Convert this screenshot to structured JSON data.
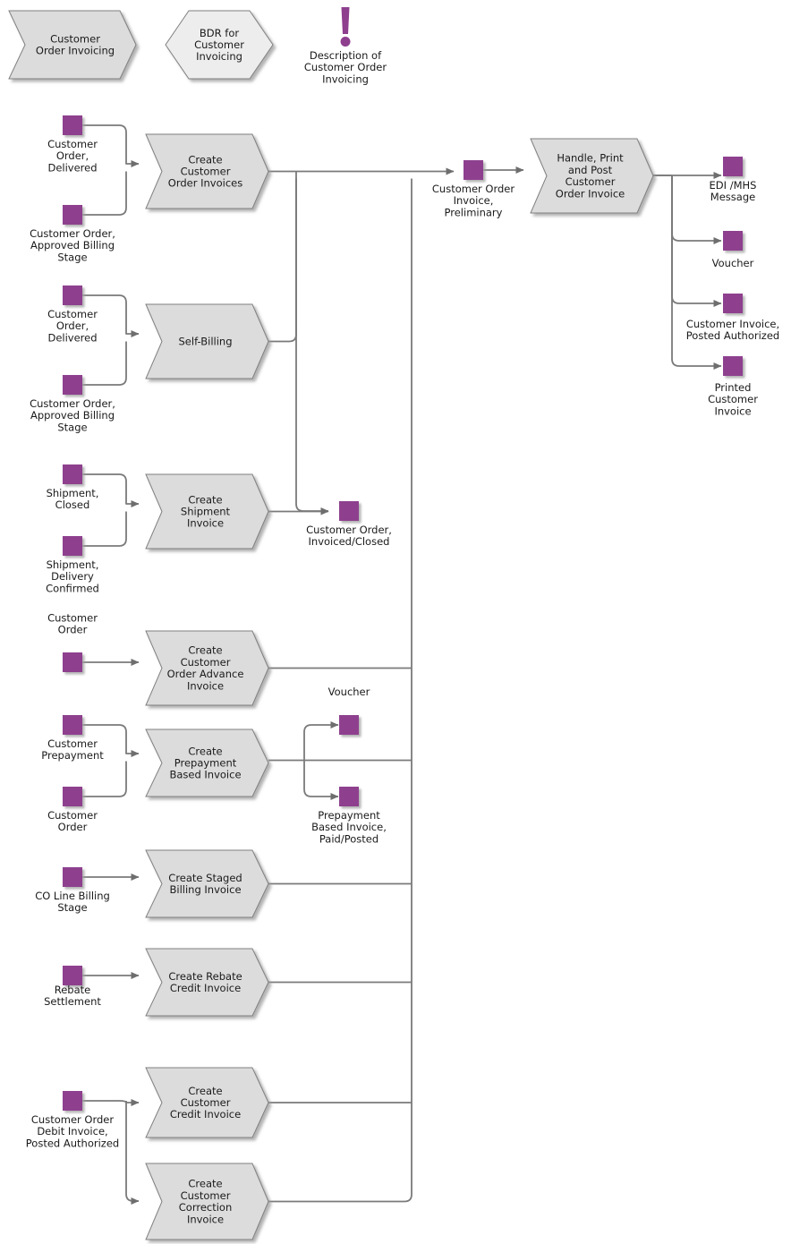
{
  "diagram": {
    "title": "Customer Order Invoicing",
    "type": "process-flow",
    "colors": {
      "accent_purple": "#8e3f8e",
      "shape_fill": "#dcdcdc",
      "hex_fill": "#ededed",
      "stroke": "#808080",
      "line": "#7a7a7a",
      "text": "#1a1a1a"
    }
  },
  "header": {
    "process_chevron": "Customer\nOrder Invoicing",
    "process_chevron_lines": [
      "Customer",
      "Order Invoicing"
    ],
    "bdr_hexagon_lines": [
      "BDR for",
      "Customer",
      "Invoicing"
    ],
    "description_icon": "exclamation-icon",
    "description_lines": [
      "Description of",
      "Customer Order",
      "Invoicing"
    ]
  },
  "activities": [
    {
      "id": "create-customer-order-invoices",
      "lines": [
        "Create",
        "Customer",
        "Order Invoices"
      ]
    },
    {
      "id": "self-billing",
      "lines": [
        "Self-Billing"
      ]
    },
    {
      "id": "create-shipment-invoice",
      "lines": [
        "Create",
        "Shipment",
        "Invoice"
      ]
    },
    {
      "id": "create-customer-order-advance-invoice",
      "lines": [
        "Create",
        "Customer",
        "Order Advance",
        "Invoice"
      ]
    },
    {
      "id": "create-prepayment-based-invoice",
      "lines": [
        "Create",
        "Prepayment",
        "Based Invoice"
      ]
    },
    {
      "id": "create-staged-billing-invoice",
      "lines": [
        "Create Staged",
        "Billing Invoice"
      ]
    },
    {
      "id": "create-rebate-credit-invoice",
      "lines": [
        "Create Rebate",
        "Credit Invoice"
      ]
    },
    {
      "id": "create-customer-credit-invoice",
      "lines": [
        "Create",
        "Customer",
        "Credit Invoice"
      ]
    },
    {
      "id": "create-customer-correction-invoice",
      "lines": [
        "Create",
        "Customer",
        "Correction",
        "Invoice"
      ]
    },
    {
      "id": "handle-print-and-post-customer-order-invoice",
      "lines": [
        "Handle, Print",
        "and Post",
        "Customer",
        "Order Invoice"
      ]
    }
  ],
  "objects": [
    {
      "id": "customer-order-delivered-1",
      "lines": [
        "Customer",
        "Order,",
        "Delivered"
      ]
    },
    {
      "id": "customer-order-approved-billing-stage-1",
      "lines": [
        "Customer Order,",
        "Approved Billing",
        "Stage"
      ]
    },
    {
      "id": "customer-order-delivered-2",
      "lines": [
        "Customer",
        "Order,",
        "Delivered"
      ]
    },
    {
      "id": "customer-order-approved-billing-stage-2",
      "lines": [
        "Customer Order,",
        "Approved Billing",
        "Stage"
      ]
    },
    {
      "id": "shipment-closed",
      "lines": [
        "Shipment,",
        "Closed"
      ]
    },
    {
      "id": "shipment-delivery-confirmed",
      "lines": [
        "Shipment,",
        "Delivery",
        "Confirmed"
      ]
    },
    {
      "id": "customer-order-advance",
      "lines": [
        "Customer",
        "Order"
      ]
    },
    {
      "id": "customer-prepayment",
      "lines": [
        "Customer",
        "Prepayment"
      ]
    },
    {
      "id": "customer-order-prepay",
      "lines": [
        "Customer",
        "Order"
      ]
    },
    {
      "id": "co-line-billing-stage",
      "lines": [
        "CO Line Billing",
        "Stage"
      ]
    },
    {
      "id": "rebate-settlement",
      "lines": [
        "Rebate",
        "Settlement"
      ]
    },
    {
      "id": "customer-order-debit-invoice-posted-authorized",
      "lines": [
        "Customer Order",
        "Debit Invoice,",
        "Posted Authorized"
      ]
    },
    {
      "id": "customer-order-invoiced-closed",
      "lines": [
        "Customer Order,",
        "Invoiced/Closed"
      ]
    },
    {
      "id": "voucher-prepay",
      "lines": [
        "Voucher"
      ]
    },
    {
      "id": "prepayment-based-invoice-paid-posted",
      "lines": [
        "Prepayment",
        "Based Invoice,",
        "Paid/Posted"
      ]
    },
    {
      "id": "customer-order-invoice-preliminary",
      "lines": [
        "Customer Order",
        "Invoice,",
        "Preliminary"
      ]
    },
    {
      "id": "edi-mhs-message",
      "lines": [
        "EDI /MHS",
        "Message"
      ]
    },
    {
      "id": "voucher-output",
      "lines": [
        "Voucher"
      ]
    },
    {
      "id": "customer-invoice-posted-authorized",
      "lines": [
        "Customer Invoice,",
        "Posted Authorized"
      ]
    },
    {
      "id": "printed-customer-invoice",
      "lines": [
        "Printed",
        "Customer",
        "Invoice"
      ]
    }
  ]
}
